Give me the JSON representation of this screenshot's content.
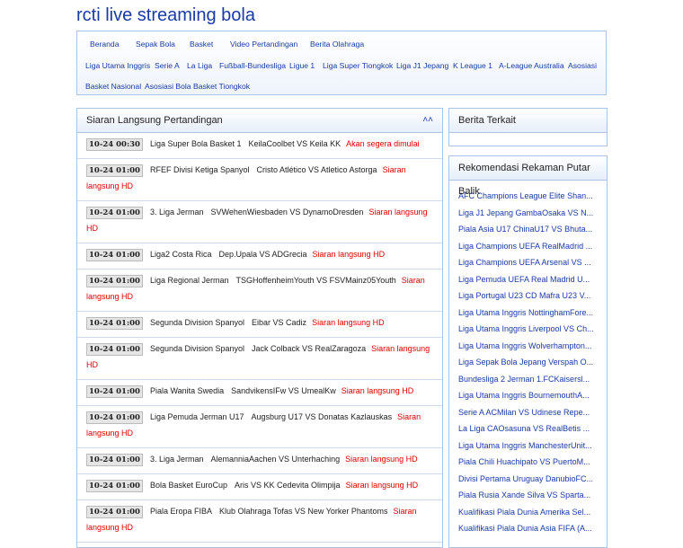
{
  "site": {
    "title": "rcti live streaming bola"
  },
  "nav": {
    "row1": [
      "Beranda",
      "Sepak Bola",
      "Basket",
      "Video Pertandingan",
      "Berita Olahraga"
    ],
    "row2": [
      "Liga Utama Inggris",
      "Serie A",
      "La Liga",
      "Fußball-Bundesliga",
      "Ligue 1",
      "Liga Super Tiongkok",
      "Liga J1 Jepang",
      "K League 1",
      "A-League Australia",
      "Asosiasi"
    ],
    "row3": [
      "Basket Nasional",
      "Asosiasi Bola Basket Tiongkok"
    ]
  },
  "live": {
    "title": "Siaran Langsung Pertandingan",
    "matches": [
      {
        "time": "10-24 00:30",
        "league": "Liga Super Bola Basket 1",
        "teams": "KeilaCoolbet VS Keila KK",
        "status": "Akan segera dimulai",
        "status2": ""
      },
      {
        "time": "10-24 01:00",
        "league": "RFEF Divisi Ketiga Spanyol",
        "teams": "Cristo Atlético VS Atletico Astorga",
        "status": "Siaran",
        "status2": "langsung HD"
      },
      {
        "time": "10-24 01:00",
        "league": "3. Liga Jerman",
        "teams": "SVWehenWiesbaden VS DynamoDresden",
        "status": "Siaran langsung",
        "status2": "HD"
      },
      {
        "time": "10-24 01:00",
        "league": "Liga2 Costa Rica",
        "teams": "Dep.Upala VS ADGrecia",
        "status": "Siaran langsung HD",
        "status2": ""
      },
      {
        "time": "10-24 01:00",
        "league": "Liga Regional Jerman",
        "teams": "TSGHoffenheimYouth VS FSVMainz05Youth",
        "status": "Siaran",
        "status2": "langsung HD"
      },
      {
        "time": "10-24 01:00",
        "league": "Segunda Division Spanyol",
        "teams": "Eibar VS Cadiz",
        "status": "Siaran langsung HD",
        "status2": ""
      },
      {
        "time": "10-24 01:00",
        "league": "Segunda Division Spanyol",
        "teams": "Jack Colback VS RealZaragoza",
        "status": "Siaran langsung",
        "status2": "HD"
      },
      {
        "time": "10-24 01:00",
        "league": "Piala Wanita Swedia",
        "teams": "SandvikensIFw VS UmealKw",
        "status": "Siaran langsung HD",
        "status2": ""
      },
      {
        "time": "10-24 01:00",
        "league": "Liga Pemuda Jerman U17",
        "teams": "Augsburg U17 VS Donatas Kazlauskas",
        "status": "Siaran",
        "status2": "langsung HD"
      },
      {
        "time": "10-24 01:00",
        "league": "3. Liga Jerman",
        "teams": "AlemanniaAachen VS Unterhaching",
        "status": "Siaran langsung HD",
        "status2": ""
      },
      {
        "time": "10-24 01:00",
        "league": "Bola Basket EuroCup",
        "teams": "Aris VS KK Cedevita Olimpija",
        "status": "Siaran langsung HD",
        "status2": ""
      },
      {
        "time": "10-24 01:00",
        "league": "Piala Eropa FIBA",
        "teams": "Klub Olahraga Tofas VS New Yorker Phantoms",
        "status": "Siaran",
        "status2": "langsung HD"
      }
    ]
  },
  "news": {
    "title": "Berita Terkait"
  },
  "replays": {
    "title": "Rekomendasi Rekaman Putar Balik",
    "items": [
      "AFC Champions League Elite Shan...",
      "Liga J1 Jepang GambaOsaka VS N...",
      "Piala Asia U17 ChinaU17 VS Bhuta...",
      "Liga Champions UEFA RealMadrid ...",
      "Liga Champions UEFA Arsenal VS ...",
      "Liga Pemuda UEFA Real Madrid U...",
      "Liga Portugal U23 CD Mafra U23 V...",
      "Liga Utama Inggris NottinghamFore...",
      "Liga Utama Inggris Liverpool VS Ch...",
      "Liga Utama Inggris Wolverhampton...",
      "Liga Sepak Bola Jepang Verspah O...",
      "Bundesliga 2 Jerman 1.FCKaisersl...",
      "Liga Utama Inggris BournemouthA...",
      "Serie A ACMilan VS Udinese Repe...",
      "La Liga CAOsasuna VS RealBetis ...",
      "Liga Utama Inggris ManchesterUnit...",
      "Piala Chili Huachipato VS PuertoM...",
      "Divisi Pertama Uruguay DanubioFC...",
      "Piala Rusia Xande Silva VS Sparta...",
      "Kualifikasi Piala Dunia Amerika Sel...",
      "Kualifikasi Piala Dunia Asia FIFA (A..."
    ]
  }
}
